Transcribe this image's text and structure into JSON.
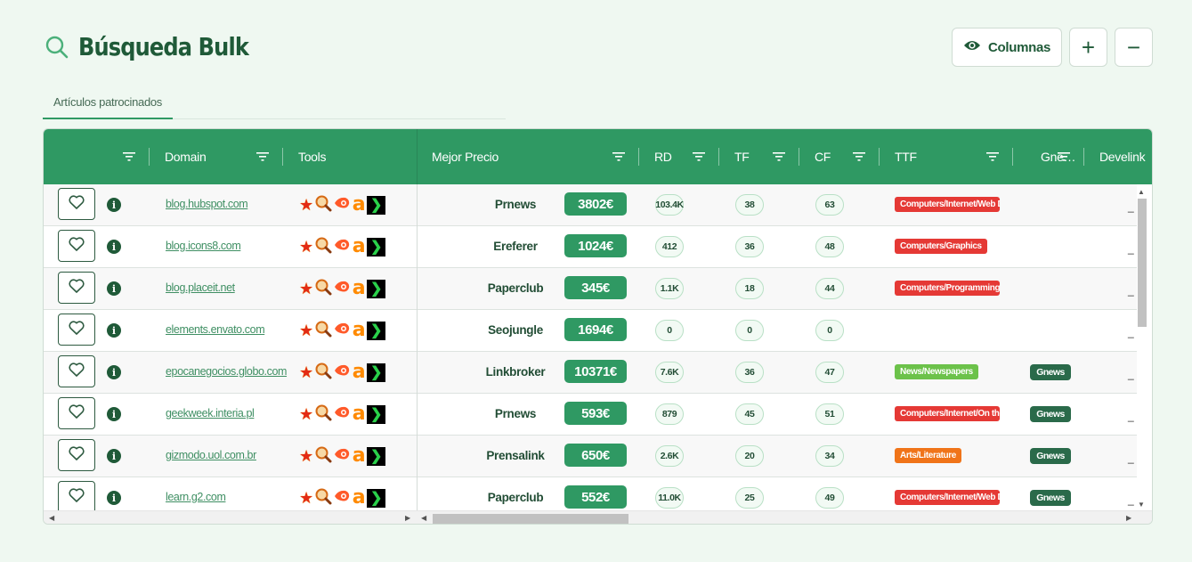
{
  "header": {
    "title": "Búsqueda Bulk",
    "columns_label": "Columnas",
    "add_label": "+",
    "remove_label": "−"
  },
  "tabs": [
    {
      "label": "Artículos patrocinados",
      "active": true
    }
  ],
  "columns": {
    "domain": "Domain",
    "tools": "Tools",
    "best_price": "Mejor Precio",
    "rd": "RD",
    "tf": "TF",
    "cf": "CF",
    "ttf": "TTF",
    "gnews": "Gne…",
    "develink": "Develink"
  },
  "colors": {
    "brand": "#2f9963",
    "title": "#1f5a38",
    "ttf_red": "#e53935",
    "ttf_green": "#6cc24a",
    "ttf_orange": "#f07419"
  },
  "rows": [
    {
      "domain": "blog.hubspot.com",
      "provider": "Prnews",
      "price": "3802€",
      "rd": "103.4K",
      "tf": "38",
      "cf": "63",
      "ttf": "Computers/Internet/Web D",
      "ttf_color": "red",
      "gnews": "",
      "develink": "_"
    },
    {
      "domain": "blog.icons8.com",
      "provider": "Ereferer",
      "price": "1024€",
      "rd": "412",
      "tf": "36",
      "cf": "48",
      "ttf": "Computers/Graphics",
      "ttf_color": "red",
      "gnews": "",
      "develink": "_"
    },
    {
      "domain": "blog.placeit.net",
      "provider": "Paperclub",
      "price": "345€",
      "rd": "1.1K",
      "tf": "18",
      "cf": "44",
      "ttf": "Computers/Programming/I",
      "ttf_color": "red",
      "gnews": "",
      "develink": "_"
    },
    {
      "domain": "elements.envato.com",
      "provider": "Seojungle",
      "price": "1694€",
      "rd": "0",
      "tf": "0",
      "cf": "0",
      "ttf": "",
      "ttf_color": "",
      "gnews": "",
      "develink": "_"
    },
    {
      "domain": "epocanegocios.globo.com",
      "provider": "Linkbroker",
      "price": "10371€",
      "rd": "7.6K",
      "tf": "36",
      "cf": "47",
      "ttf": "News/Newspapers",
      "ttf_color": "green",
      "gnews": "Gnews",
      "develink": "_"
    },
    {
      "domain": "geekweek.interia.pl",
      "provider": "Prnews",
      "price": "593€",
      "rd": "879",
      "tf": "45",
      "cf": "51",
      "ttf": "Computers/Internet/On the",
      "ttf_color": "red",
      "gnews": "Gnews",
      "develink": "_"
    },
    {
      "domain": "gizmodo.uol.com.br",
      "provider": "Prensalink",
      "price": "650€",
      "rd": "2.6K",
      "tf": "20",
      "cf": "34",
      "ttf": "Arts/Literature",
      "ttf_color": "orange",
      "gnews": "Gnews",
      "develink": "_"
    },
    {
      "domain": "learn.g2.com",
      "provider": "Paperclub",
      "price": "552€",
      "rd": "11.0K",
      "tf": "25",
      "cf": "49",
      "ttf": "Computers/Internet/Web D",
      "ttf_color": "red",
      "gnews": "Gnews",
      "develink": "_"
    }
  ],
  "tool_icons": [
    "star-icon",
    "magnifier-icon",
    "flame-icon",
    "ahrefs-a-icon",
    "chevron-box-icon"
  ]
}
